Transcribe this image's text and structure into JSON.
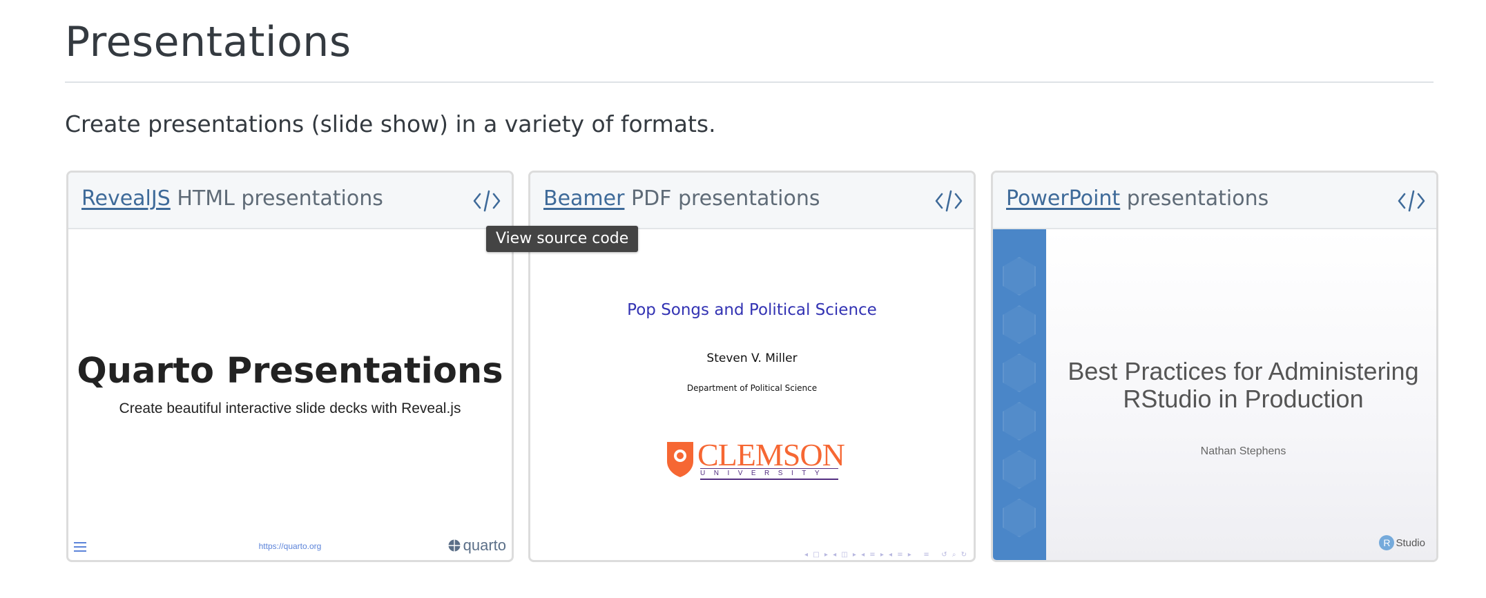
{
  "page": {
    "title": "Presentations",
    "lead": "Create presentations (slide show) in a variety of formats."
  },
  "tooltip": "View source code",
  "cards": [
    {
      "link": "RevealJS",
      "rest": " HTML presentations",
      "icon": "code-icon",
      "thumb": {
        "title": "Quarto Presentations",
        "subtitle": "Create beautiful interactive slide decks with Reveal.js",
        "url": "https://quarto.org",
        "logo": "quarto"
      }
    },
    {
      "link": "Beamer",
      "rest": " PDF presentations",
      "icon": "code-icon",
      "thumb": {
        "title": "Pop Songs and Political Science",
        "author": "Steven V. Miller",
        "institution": "Department of Political Science",
        "logo_word": "CLEMSON",
        "logo_sub": "UNIVERSITY"
      }
    },
    {
      "link": "PowerPoint",
      "rest": " presentations",
      "icon": "code-icon",
      "thumb": {
        "title_line1": "Best Practices for Administering",
        "title_line2": "RStudio in Production",
        "author": "Nathan Stephens",
        "logo_letter": "R",
        "logo_text": "Studio"
      }
    }
  ],
  "colors": {
    "link": "#3e6a99",
    "beamer_title": "#3333b3",
    "clemson_orange": "#f66733",
    "clemson_purple": "#522d80",
    "ppt_stripe": "#4a86c8"
  }
}
